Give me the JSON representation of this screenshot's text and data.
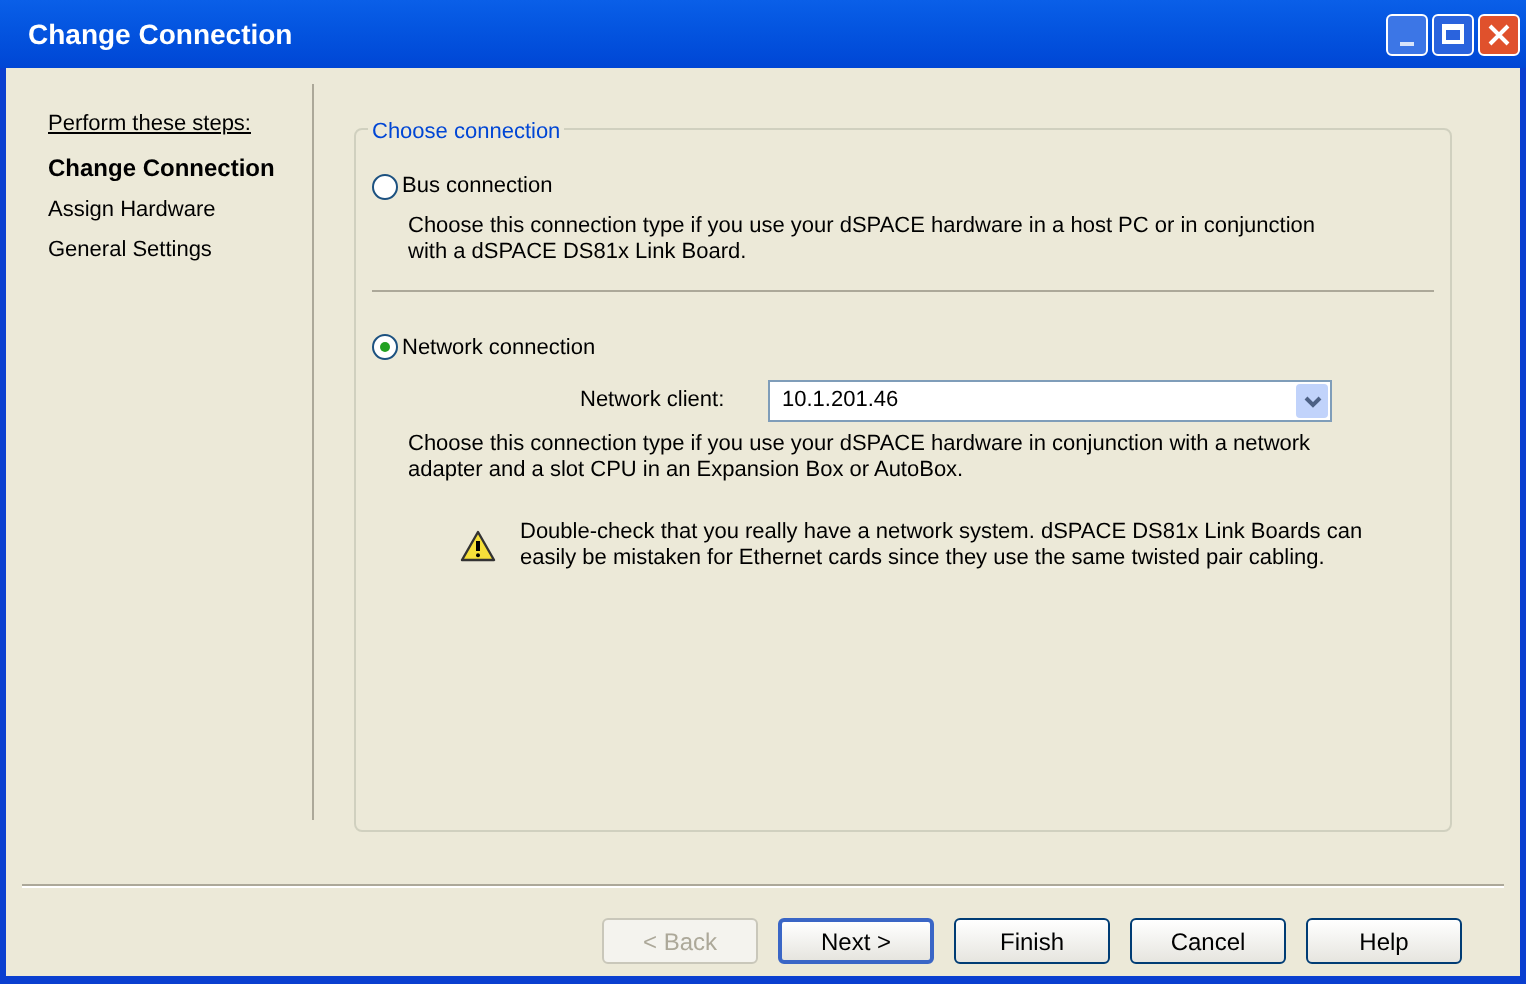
{
  "window": {
    "title": "Change Connection"
  },
  "steps": {
    "heading": "Perform these steps:",
    "items": [
      {
        "label": "Change Connection",
        "selected": true
      },
      {
        "label": "Assign Hardware",
        "selected": false
      },
      {
        "label": "General Settings",
        "selected": false
      }
    ]
  },
  "group": {
    "title": "Choose connection",
    "options": [
      {
        "label": "Bus connection",
        "selected": false,
        "description": "Choose this connection type if you use your dSPACE hardware in a host PC or in conjunction with a dSPACE DS81x Link Board."
      },
      {
        "label": "Network connection",
        "selected": true,
        "field_label": "Network client:",
        "field_value": "10.1.201.46",
        "description": "Choose this connection type if you use your dSPACE hardware in conjunction with a network adapter and a slot CPU in an Expansion Box or AutoBox.",
        "warning": "Double-check that you really have a network system. dSPACE DS81x Link Boards can easily be mistaken for Ethernet cards since they use the same twisted pair cabling."
      }
    ]
  },
  "buttons": [
    {
      "label": "< Back",
      "disabled": true,
      "default": false
    },
    {
      "label": "Next >",
      "disabled": false,
      "default": true
    },
    {
      "label": "Finish",
      "disabled": false,
      "default": false
    },
    {
      "label": "Cancel",
      "disabled": false,
      "default": false
    },
    {
      "label": "Help",
      "disabled": false,
      "default": false
    }
  ]
}
